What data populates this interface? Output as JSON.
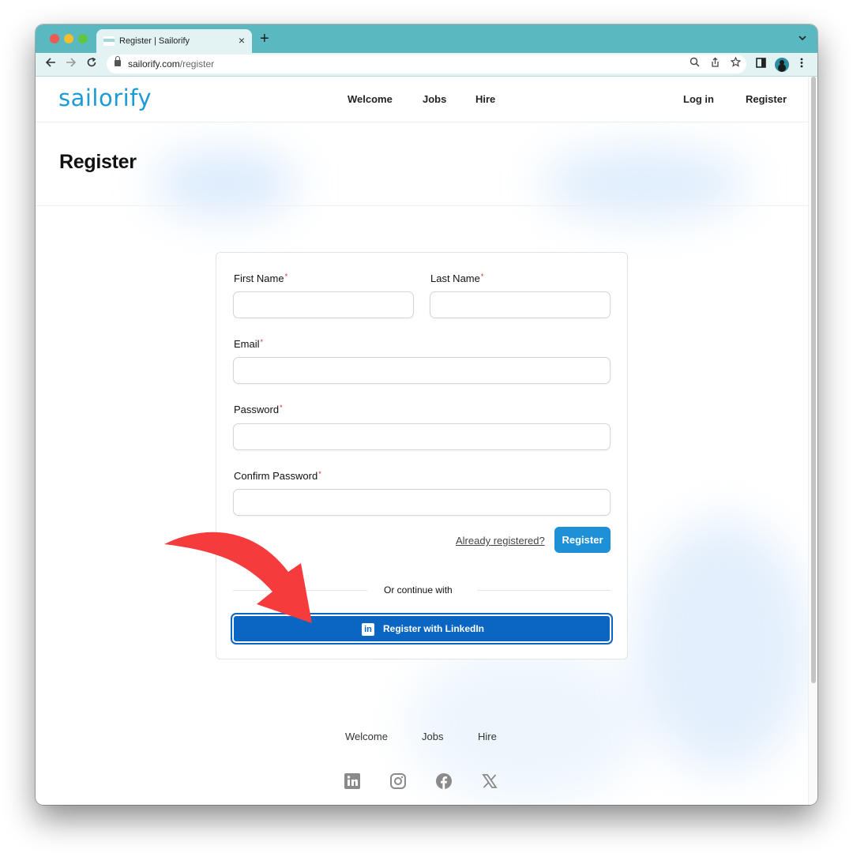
{
  "browser": {
    "tab_title": "Register | Sailorify",
    "tab_close": "×",
    "new_tab": "+",
    "tab_menu": "⌄",
    "url_host": "sailorify.com",
    "url_path": "/register"
  },
  "header": {
    "logo": "sailorify",
    "nav": [
      "Welcome",
      "Jobs",
      "Hire"
    ],
    "login": "Log in",
    "register": "Register"
  },
  "hero": {
    "title": "Register"
  },
  "form": {
    "required_mark": "*",
    "first_name": {
      "label": "First Name",
      "value": ""
    },
    "last_name": {
      "label": "Last Name",
      "value": ""
    },
    "email": {
      "label": "Email",
      "value": ""
    },
    "password": {
      "label": "Password",
      "value": ""
    },
    "confirm_password": {
      "label": "Confirm Password",
      "value": ""
    },
    "already_registered": "Already registered?",
    "submit": "Register",
    "divider": "Or continue with",
    "linkedin": "Register with LinkedIn"
  },
  "footer": {
    "links": [
      "Welcome",
      "Jobs",
      "Hire"
    ],
    "social_icons": [
      "linkedin-icon",
      "instagram-icon",
      "facebook-icon",
      "x-icon"
    ]
  },
  "colors": {
    "brand": "#1d9bd6",
    "primary_button": "#1e90d8",
    "linkedin": "#0a66c2",
    "required": "#e02424",
    "annotation_arrow": "#f53b3b",
    "chrome": "#5ab8c0"
  }
}
